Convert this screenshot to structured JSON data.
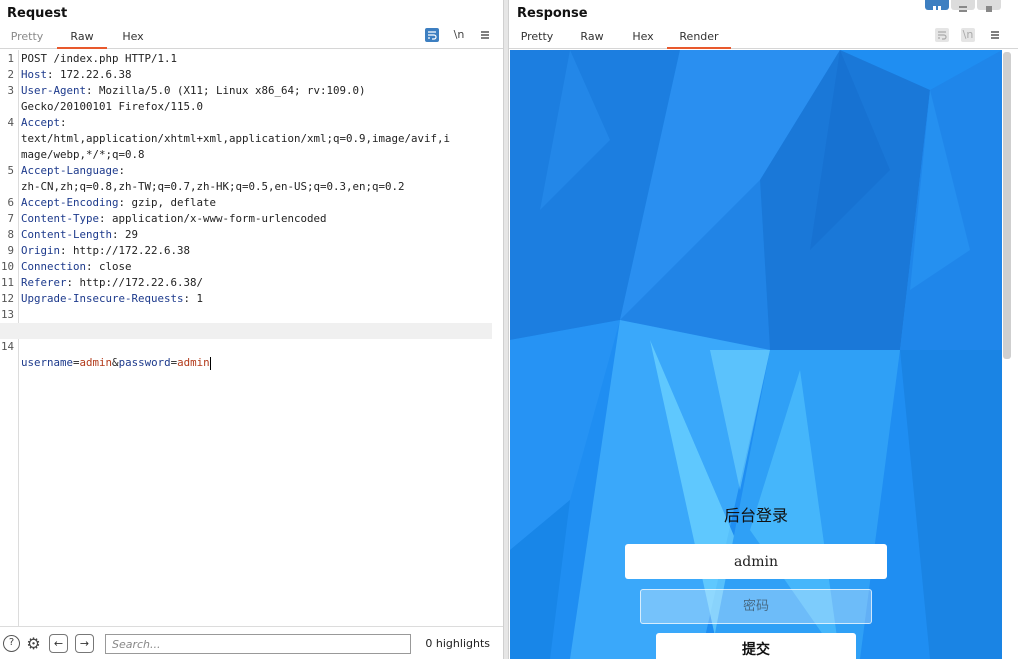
{
  "request": {
    "title": "Request",
    "tabs": [
      {
        "label": "Pretty",
        "dim": true
      },
      {
        "label": "Raw",
        "active": true
      },
      {
        "label": "Hex"
      }
    ],
    "tool_icons": [
      "wrap-lines-icon",
      "newline-toggle-icon",
      "menu-icon"
    ],
    "newline_glyph": "\\n",
    "lines": [
      {
        "n": "1",
        "plain": "POST /index.php HTTP/1.1"
      },
      {
        "n": "2",
        "name": "Host",
        "value": ": 172.22.6.38"
      },
      {
        "n": "3",
        "name": "User-Agent",
        "value": ": Mozilla/5.0 (X11; Linux x86_64; rv:109.0)"
      },
      {
        "n": "",
        "plain": "Gecko/20100101 Firefox/115.0"
      },
      {
        "n": "4",
        "name": "Accept",
        "value": ":"
      },
      {
        "n": "",
        "plain": "text/html,application/xhtml+xml,application/xml;q=0.9,image/avif,i"
      },
      {
        "n": "",
        "plain": "mage/webp,*/*;q=0.8"
      },
      {
        "n": "5",
        "name": "Accept-Language",
        "value": ":"
      },
      {
        "n": "",
        "plain": "zh-CN,zh;q=0.8,zh-TW;q=0.7,zh-HK;q=0.5,en-US;q=0.3,en;q=0.2"
      },
      {
        "n": "6",
        "name": "Accept-Encoding",
        "value": ": gzip, deflate"
      },
      {
        "n": "7",
        "name": "Content-Type",
        "value": ": application/x-www-form-urlencoded"
      },
      {
        "n": "8",
        "name": "Content-Length",
        "value": ": 29"
      },
      {
        "n": "9",
        "name": "Origin",
        "value": ": http://172.22.6.38"
      },
      {
        "n": "10",
        "name": "Connection",
        "value": ": close"
      },
      {
        "n": "11",
        "name": "Referer",
        "value": ": http://172.22.6.38/"
      },
      {
        "n": "12",
        "name": "Upgrade-Insecure-Requests",
        "value": ": 1"
      },
      {
        "n": "13",
        "plain": ""
      }
    ],
    "body_line": {
      "n": "14",
      "k1": "username",
      "eq1": "=",
      "v1": "admin",
      "amp": "&",
      "k2": "password",
      "eq2": "=",
      "v2": "admin"
    },
    "bottom": {
      "search_placeholder": "Search...",
      "highlights": "0 highlights",
      "help_glyph": "?",
      "settings_glyph": "⚙",
      "back_glyph": "←",
      "forward_glyph": "→"
    }
  },
  "response": {
    "title": "Response",
    "tabs": [
      {
        "label": "Pretty"
      },
      {
        "label": "Raw"
      },
      {
        "label": "Hex"
      },
      {
        "label": "Render",
        "active": true
      }
    ],
    "newline_glyph": "\\n",
    "render": {
      "heading": "后台登录",
      "username_value": "admin",
      "password_placeholder": "密码",
      "submit_label": "提交"
    }
  },
  "colors": {
    "accent_tab": "#e8592d",
    "header_name": "#1d3a8c",
    "param_value": "#b23a1a",
    "render_bg": "#1e8cf0",
    "layout_active": "#3d7fc1"
  }
}
